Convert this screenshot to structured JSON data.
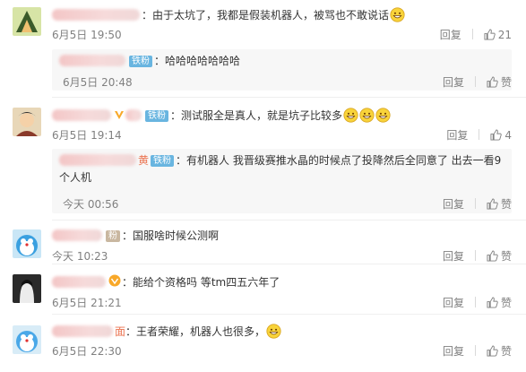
{
  "comments": [
    {
      "text": "：由于太坑了，我都是假装机器人，被骂也不敢说话",
      "date": "6月5日 19:50",
      "reply_label": "回复",
      "like_count": "21",
      "reply": {
        "badge": "铁粉",
        "text": "：哈哈哈哈哈哈哈",
        "date": "6月5日 20:48",
        "reply_label": "回复",
        "like_label": "赞"
      }
    },
    {
      "badge": "铁粉",
      "text": "：测试服全是真人，就是坑子比较多",
      "date": "6月5日 19:14",
      "reply_label": "回复",
      "like_count": "4",
      "reply": {
        "name_fragment": "黄",
        "badge": "铁粉",
        "text": "：有机器人 我晋级赛推水晶的时候点了投降然后全同意了 出去一看9个人机",
        "date": "今天 00:56",
        "reply_label": "回复",
        "like_label": "赞"
      }
    },
    {
      "badge": "粉",
      "text": "：国服啥时候公测啊",
      "date": "今天 10:23",
      "reply_label": "回复",
      "like_label": "赞"
    },
    {
      "text": "：能给个资格吗 等tm四五六年了",
      "date": "6月5日 21:21",
      "reply_label": "回复",
      "like_label": "赞"
    },
    {
      "name_fragment": "面",
      "text": "：王者荣耀，机器人也很多，",
      "date": "6月5日 22:30",
      "reply_label": "回复",
      "like_label": "赞"
    }
  ],
  "icons": {
    "badge_color": "#69b5e0",
    "username_color": "#eb7350",
    "emoji": "grinning-face-emoji",
    "thumb": "thumbs-up-icon"
  }
}
